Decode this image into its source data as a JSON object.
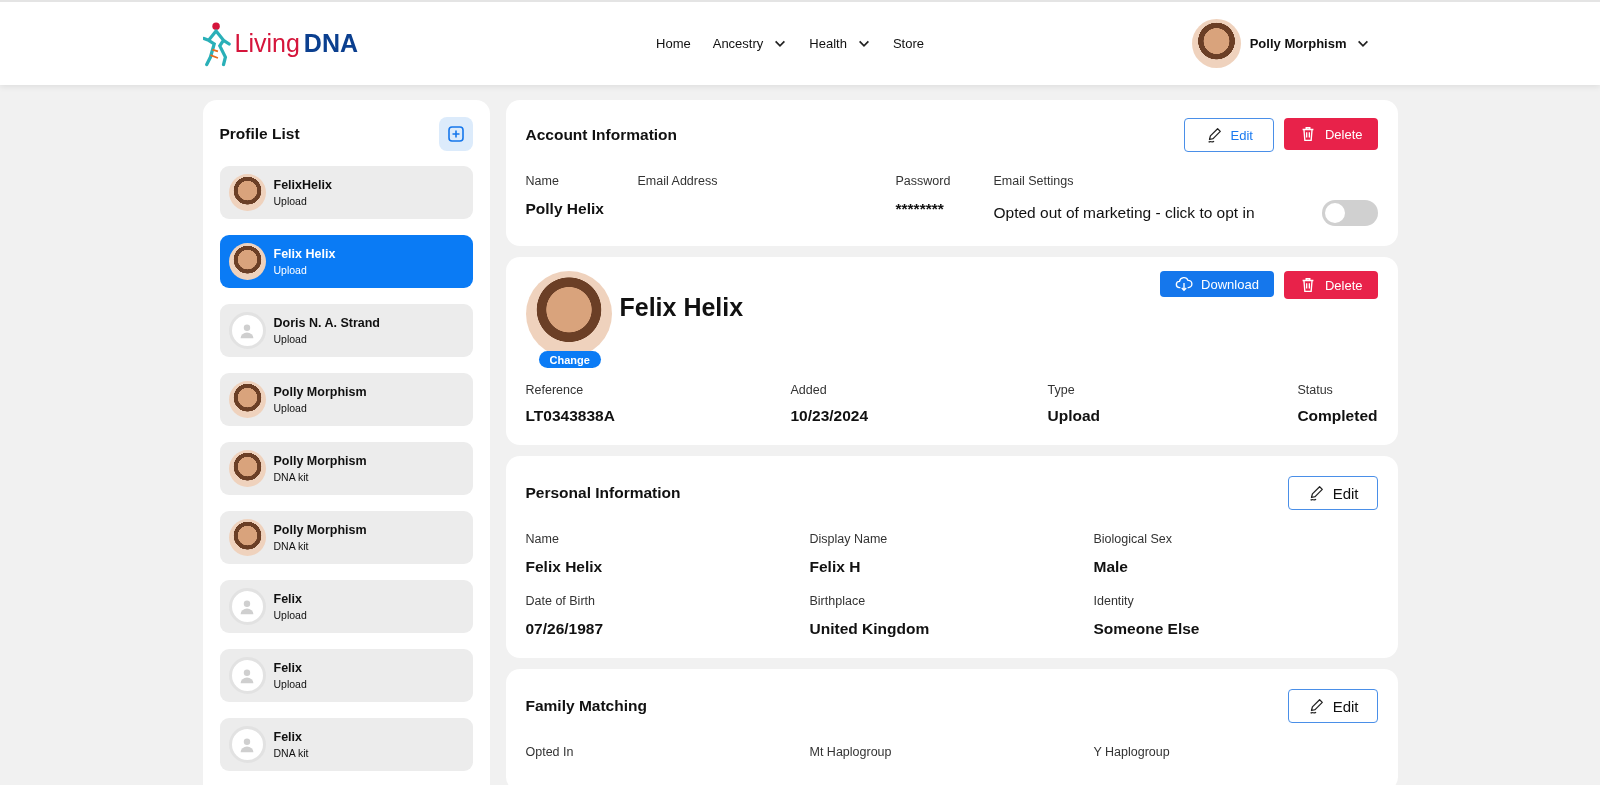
{
  "header": {
    "logo": {
      "first": "Living",
      "second": "DNA"
    },
    "nav": [
      {
        "label": "Home",
        "dropdown": false
      },
      {
        "label": "Ancestry",
        "dropdown": true
      },
      {
        "label": "Health",
        "dropdown": true
      },
      {
        "label": "Store",
        "dropdown": false
      }
    ],
    "user": {
      "name": "Polly Morphism"
    }
  },
  "profile_list": {
    "title": "Profile List",
    "items": [
      {
        "name": "FelixHelix",
        "source": "Upload",
        "kind": "picture",
        "selected": false
      },
      {
        "name": "Felix Helix",
        "source": "Upload",
        "kind": "picture",
        "selected": true
      },
      {
        "name": "Doris N. A. Strand",
        "source": "Upload",
        "kind": "silhouette",
        "selected": false
      },
      {
        "name": "Polly Morphism",
        "source": "Upload",
        "kind": "picture",
        "selected": false
      },
      {
        "name": "Polly Morphism",
        "source": "DNA kit",
        "kind": "picture",
        "selected": false
      },
      {
        "name": "Polly Morphism",
        "source": "DNA kit",
        "kind": "picture",
        "selected": false
      },
      {
        "name": "Felix",
        "source": "Upload",
        "kind": "silhouette",
        "selected": false
      },
      {
        "name": "Felix",
        "source": "Upload",
        "kind": "silhouette",
        "selected": false
      },
      {
        "name": "Felix",
        "source": "DNA kit",
        "kind": "silhouette",
        "selected": false
      }
    ]
  },
  "account": {
    "title": "Account Information",
    "buttons": [
      {
        "label": "Edit",
        "kind": "edit"
      },
      {
        "label": "Delete",
        "kind": "delete"
      }
    ],
    "fields": [
      {
        "label": "Name",
        "value": "Polly Helix"
      },
      {
        "label": "Email Address"
      },
      {
        "label": "Password",
        "value": "********"
      }
    ],
    "email_settings": {
      "label": "Email Settings",
      "text": "Opted out of marketing - click to opt in",
      "on": false
    }
  },
  "profile": {
    "name": "Felix Helix",
    "change_label": "Change",
    "buttons": [
      {
        "label": "Download",
        "kind": "download"
      },
      {
        "label": "Delete",
        "kind": "delete"
      }
    ],
    "fields": [
      {
        "label": "Reference",
        "value": "LT0343838A"
      },
      {
        "label": "Added",
        "value": "10/23/2024"
      },
      {
        "label": "Type",
        "value": "Upload"
      },
      {
        "label": "Status",
        "value": "Completed"
      }
    ]
  },
  "personal": {
    "title": "Personal Information",
    "buttons": [
      {
        "label": "Edit",
        "kind": "edit-dark"
      }
    ],
    "fields": [
      {
        "label": "Name",
        "value": "Felix Helix"
      },
      {
        "label": "Display Name",
        "value": "Felix H"
      },
      {
        "label": "Biological Sex",
        "value": "Male"
      },
      {
        "label": "Date of Birth",
        "value": "07/26/1987"
      },
      {
        "label": "Birthplace",
        "value": "United Kingdom"
      },
      {
        "label": "Identity",
        "value": "Someone Else"
      }
    ]
  },
  "family": {
    "title": "Family Matching",
    "buttons": [
      {
        "label": "Edit",
        "kind": "edit-dark"
      }
    ],
    "fields": [
      {
        "label": "Opted In"
      },
      {
        "label": "Mt Haplogroup"
      },
      {
        "label": "Y Haplogroup"
      }
    ]
  }
}
